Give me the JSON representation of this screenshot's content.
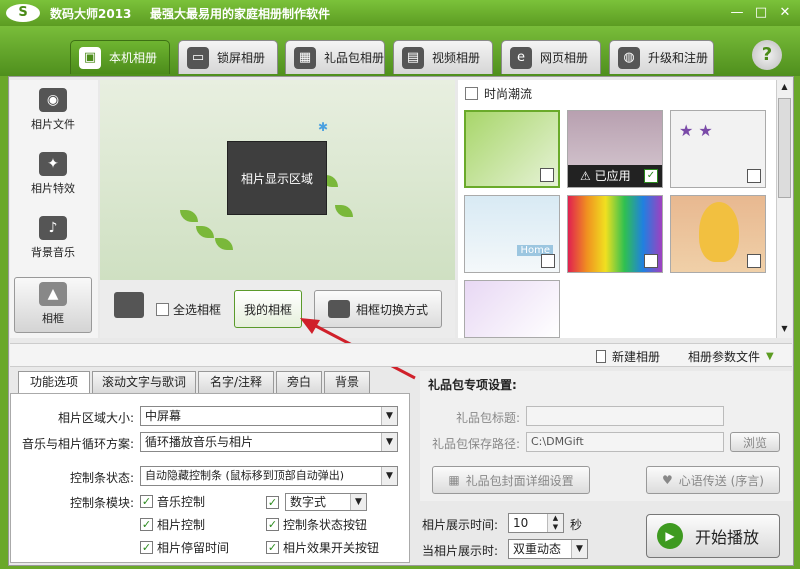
{
  "window": {
    "logo": "S",
    "title": "数码大师2013",
    "tagline": "最强大最易用的家庭相册制作软件",
    "min": "—",
    "max": "□",
    "close": "✕"
  },
  "tabs": [
    {
      "label": "本机相册",
      "icon": "photo-frame-icon"
    },
    {
      "label": "锁屏相册",
      "icon": "monitor-icon"
    },
    {
      "label": "礼品包相册",
      "icon": "gift-icon"
    },
    {
      "label": "视频相册",
      "icon": "film-icon"
    },
    {
      "label": "网页相册",
      "icon": "ie-icon"
    },
    {
      "label": "升级和注册",
      "icon": "globe-icon"
    }
  ],
  "help": "?",
  "sidebar": {
    "items": [
      {
        "label": "相片文件",
        "icon": "camera-icon"
      },
      {
        "label": "相片特效",
        "icon": "effects-icon"
      },
      {
        "label": "背景音乐",
        "icon": "music-note-icon"
      },
      {
        "label": "相框",
        "icon": "frame-icon"
      }
    ]
  },
  "preview": {
    "photo_area": "相片显示区域"
  },
  "frame_controls": {
    "select_all": "全选相框",
    "my_frames": "我的相框",
    "switch_mode": "相框切换方式"
  },
  "thumbs": {
    "category": "时尚潮流",
    "applied_label": "已应用",
    "home_text": "Home"
  },
  "toolbar2": {
    "new_album": "新建相册",
    "album_params": "相册参数文件"
  },
  "subtabs": [
    "功能选项",
    "滚动文字与歌词",
    "名字/注释",
    "旁白",
    "背景"
  ],
  "options": {
    "photo_area_size_label": "相片区域大小:",
    "photo_area_size_value": "中屏幕",
    "loop_label": "音乐与相片循环方案:",
    "loop_value": "循环播放音乐与相片",
    "controlbar_state_label": "控制条状态:",
    "controlbar_state_value": "自动隐藏控制条 (鼠标移到顶部自动弹出)",
    "controlbar_module_label": "控制条模块:",
    "music_control": "音乐控制",
    "digital_style": "数字式",
    "photo_control": "相片控制",
    "status_button": "控制条状态按钮",
    "photo_stay": "相片停留时间",
    "effect_switch": "相片效果开关按钮"
  },
  "gift": {
    "header": "礼品包专项设置:",
    "title_label": "礼品包标题:",
    "title_value": "",
    "path_label": "礼品包保存路径:",
    "path_value": "C:\\DMGift",
    "browse": "浏览",
    "cover_settings": "礼品包封面详细设置",
    "heart_message": "心语传送 (序言)"
  },
  "timing": {
    "display_time_label": "相片展示时间:",
    "display_time_value": "10",
    "unit": "秒",
    "when_label": "当相片展示时:",
    "when_value": "双重动态"
  },
  "start_button": "开始播放",
  "colors": {
    "accent": "#5c9c22",
    "arrow": "#d0202a"
  }
}
